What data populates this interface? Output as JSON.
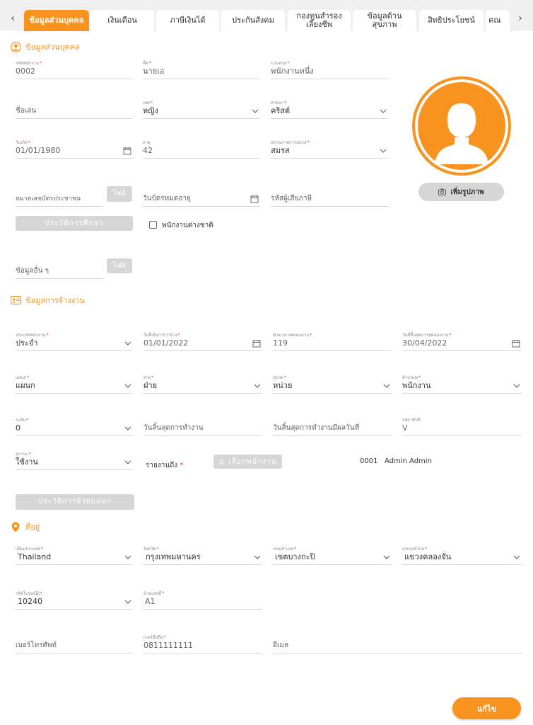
{
  "tabs": [
    {
      "label": "ข้อมูลส่วนบุคคล",
      "active": true
    },
    {
      "label": "เงินเดือน"
    },
    {
      "label": "ภาษีเงินได้"
    },
    {
      "label": "ประกันสังคม"
    },
    {
      "label": "กองทุนสำรอง\nเลี้ยงชีพ"
    },
    {
      "label": "ข้อมูลด้าน\nสุขภาพ"
    },
    {
      "label": "สิทธิประโยชน์"
    },
    {
      "label": "คณ"
    }
  ],
  "nav": {
    "prev": "‹",
    "next": "›"
  },
  "personal": {
    "title": "ข้อมูลส่วนบุคคล",
    "employee_id": {
      "label": "รหัสพนักงาน",
      "value": "0002"
    },
    "first_name": {
      "label": "ชื่อ",
      "value": "นายเอ"
    },
    "last_name": {
      "label": "นามสกุล",
      "value": "พนักงานหนึ่ง"
    },
    "nickname": {
      "placeholder": "ชื่อเล่น"
    },
    "gender": {
      "label": "เพศ",
      "value": "หญิง"
    },
    "religion": {
      "label": "ศาสนา",
      "value": "คริสต์"
    },
    "birthdate": {
      "label": "วันเกิด",
      "value": "01/01/1980"
    },
    "age": {
      "label": "อายุ",
      "value": "42"
    },
    "marital": {
      "label": "สถานภาพการสมรส",
      "value": "สมรส"
    },
    "id_card": {
      "placeholder": "หมายเลขบัตรประชาชน"
    },
    "id_file": "ไฟล์",
    "card_expiry": {
      "placeholder": "วันบัตรหมดอายุ"
    },
    "tax_id": {
      "placeholder": "รหัสผู้เสียภาษี"
    },
    "education_btn": "ประวัติการศึกษา",
    "foreign_label": "พนักงานต่างชาติ",
    "other_info": {
      "placeholder": "ข้อมูลอื่น ๆ"
    },
    "other_file": "ไฟล์",
    "add_photo": "เพิ่มรูปภาพ"
  },
  "employment": {
    "title": "ข้อมูลการจ้างงาน",
    "emp_type": {
      "label": "ประเภทพนักงาน",
      "value": "ประจำ"
    },
    "start_date": {
      "label": "วันที่เริ่มการว่าจ้าง",
      "value": "01/01/2022"
    },
    "probation": {
      "label": "ช่วงเวลาทดลองงาน",
      "value": "119"
    },
    "probation_end": {
      "label": "วันที่สิ้นสุดการทดลองงาน",
      "value": "30/04/2022"
    },
    "department": {
      "label": "แผนก",
      "value": "แผนก"
    },
    "division": {
      "label": "ฝ่าย",
      "value": "ฝ่าย"
    },
    "unit": {
      "label": "หน่วย",
      "value": "หน่วย"
    },
    "position": {
      "label": "ตำแหน่ง",
      "value": "พนักงาน"
    },
    "level": {
      "label": "ระดับ",
      "value": "0"
    },
    "last_work_day": {
      "placeholder": "วันสิ้นสุดการทำงาน"
    },
    "effective_end": {
      "placeholder": "วันสิ้นสุดการทำงานมีผลวันที่"
    },
    "shift": {
      "label": "รหัส Shift",
      "value": "V"
    },
    "status": {
      "label": "สถานะ",
      "value": "ใช้งาน"
    },
    "report_to": "รายงานถึง",
    "select_employee": "เลือกพนักงาน",
    "report_value": "0001   Admin Admin",
    "dept_history_btn": "ประวัติการย้ายแผนก"
  },
  "address": {
    "title": "ที่อยู่",
    "country": {
      "label": "เมือง/ประเทศ",
      "value": "Thailand"
    },
    "province": {
      "label": "จังหวัด",
      "value": "กรุงเทพมหานคร"
    },
    "district": {
      "label": "เขต/อำเภอ",
      "value": "เขตบางกะปิ"
    },
    "subdistrict": {
      "label": "แขวง/ตำบล",
      "value": "แขวงคลองจั่น"
    },
    "postcode": {
      "label": "รหัสไปรษณีย์",
      "value": "10240"
    },
    "house_no": {
      "label": "บ้านเลขที่",
      "value": "A1"
    },
    "phone": {
      "placeholder": "เบอร์โทรศัพท์"
    },
    "mobile": {
      "label": "เบอร์มือถือ",
      "value": "0811111111"
    },
    "email": {
      "placeholder": "อีเมล"
    }
  },
  "actions": {
    "edit": "แก้ไข"
  },
  "colors": {
    "accent": "#f7931e",
    "required": "#e53935",
    "disabled": "#d6d6d6"
  }
}
